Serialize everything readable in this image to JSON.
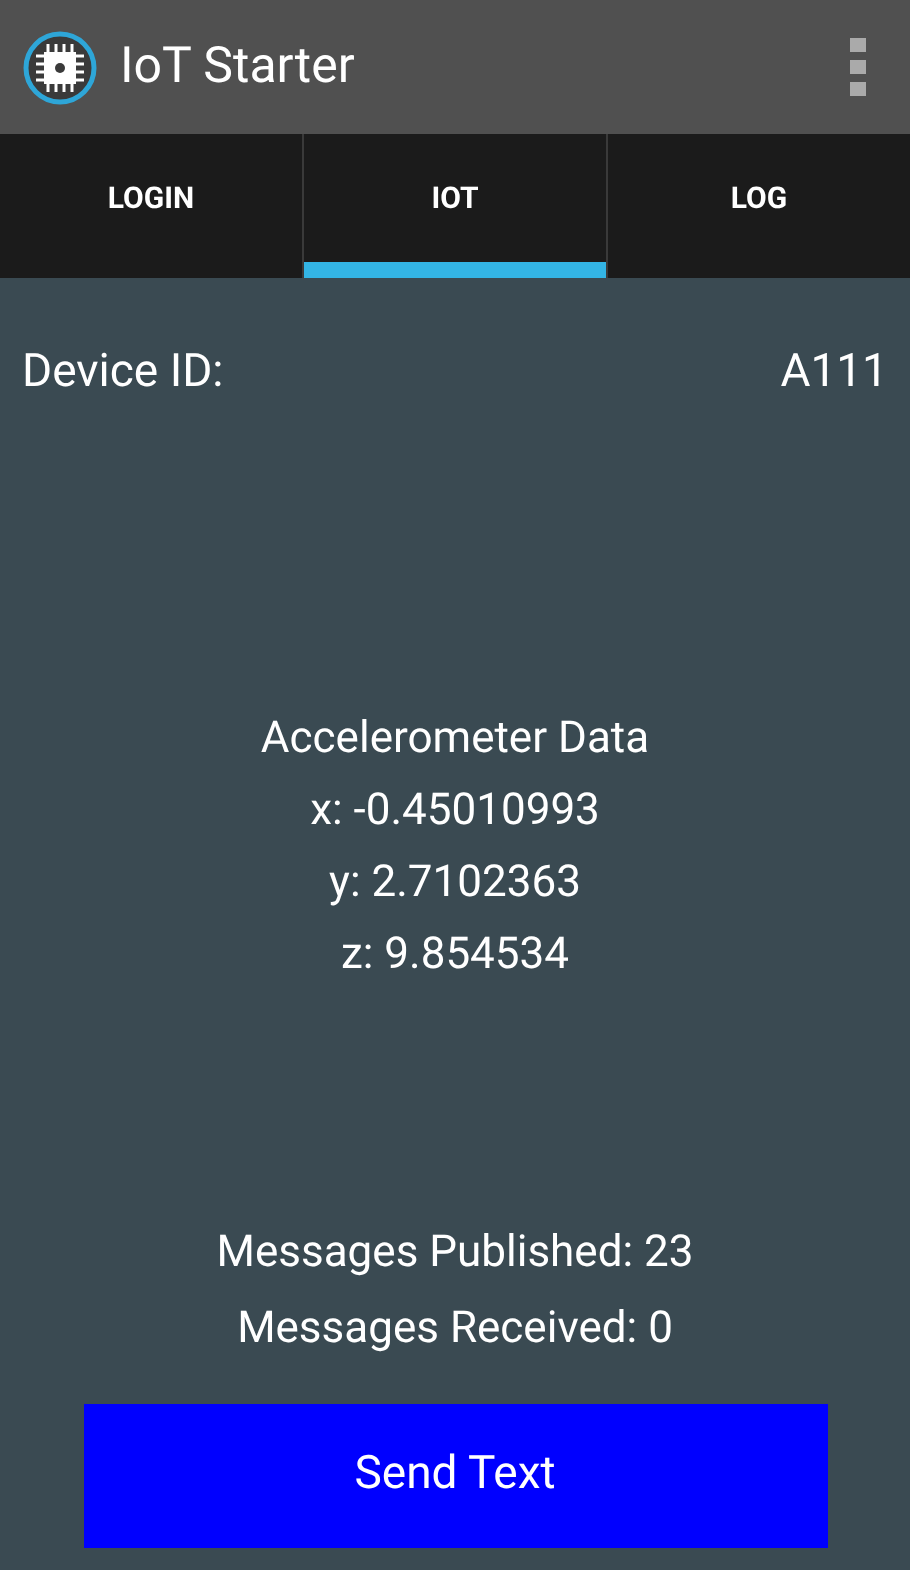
{
  "app_bar": {
    "title": "IoT Starter"
  },
  "tabs": [
    {
      "label": "LOGIN",
      "selected": false
    },
    {
      "label": "IOT",
      "selected": true
    },
    {
      "label": "LOG",
      "selected": false
    }
  ],
  "device": {
    "label": "Device ID:",
    "value": "A111"
  },
  "accelerometer": {
    "heading": "Accelerometer Data",
    "lines": [
      "x: -0.45010993",
      "y: 2.7102363",
      "z: 9.854534"
    ]
  },
  "messages": [
    "Messages Published: 23",
    "Messages Received: 0"
  ],
  "button": {
    "label": "Send Text"
  }
}
